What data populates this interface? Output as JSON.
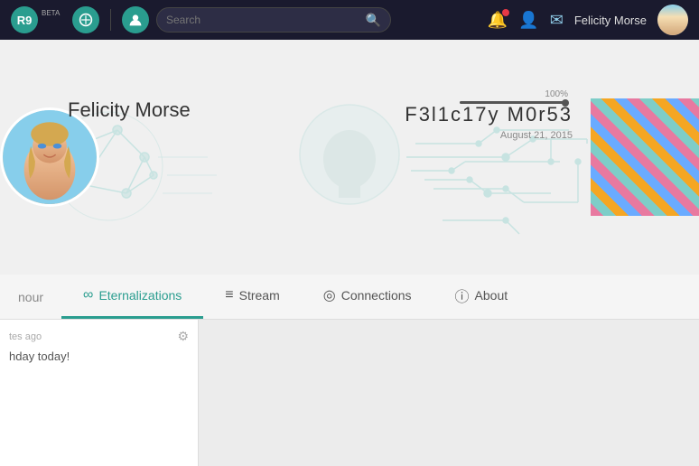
{
  "app": {
    "beta_label": "BETA",
    "logo_text": "R9"
  },
  "topnav": {
    "search_placeholder": "Search",
    "username": "Felicity Morse",
    "notification_dot": true
  },
  "profile": {
    "name": "Felicity Morse",
    "handle": "F3l1c17y M0r53",
    "date": "August 21, 2015",
    "progress_label": "100%",
    "progress_value": 100
  },
  "tabs": {
    "honour_label": "nour",
    "eternalizations_label": "Eternalizations",
    "stream_label": "Stream",
    "connections_label": "Connections",
    "about_label": "About"
  },
  "feed": {
    "time_ago": "tes ago",
    "post_text": "hday today!"
  }
}
